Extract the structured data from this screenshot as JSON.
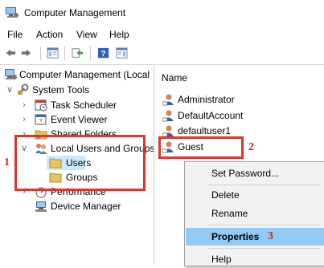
{
  "window": {
    "title": "Computer Management"
  },
  "menu": [
    "File",
    "Action",
    "View",
    "Help"
  ],
  "toolbar": {
    "buttons": [
      "back-arrow-icon",
      "forward-arrow-icon",
      "show-hide-tree-icon",
      "export-list-icon",
      "help-icon",
      "show-action-pane-icon"
    ]
  },
  "tree": {
    "root": "Computer Management (Local",
    "system_tools": "System Tools",
    "task_scheduler": "Task Scheduler",
    "event_viewer": "Event Viewer",
    "shared_folders": "Shared Folders",
    "local_users_groups": "Local Users and Groups",
    "users": "Users",
    "groups": "Groups",
    "performance": "Performance",
    "device_manager": "Device Manager"
  },
  "list": {
    "header": "Name",
    "users": [
      "Administrator",
      "DefaultAccount",
      "defaultuser1",
      "Guest"
    ]
  },
  "context_menu": {
    "set_password": "Set Password...",
    "delete": "Delete",
    "rename": "Rename",
    "properties": "Properties",
    "help": "Help"
  },
  "annotations": {
    "step1": "1",
    "step2": "2",
    "step3": "3",
    "color": "#e0342c"
  },
  "colors": {
    "selection": "#cce8ff",
    "menu_highlight": "#91c9f7",
    "folder": "#e8c25a"
  }
}
